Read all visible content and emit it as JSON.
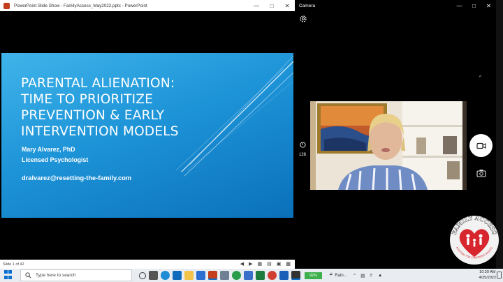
{
  "powerpoint": {
    "window_title": "PowerPoint Slide Show  -  FamilyAccess_May2022.pptx  -  PowerPoint",
    "slide": {
      "title_lines": [
        "PARENTAL ALIENATION:",
        "TIME TO PRIORITIZE",
        "PREVENTION & EARLY",
        "INTERVENTION MODELS"
      ],
      "author": "Mary Alvarez, PhD",
      "role": "Licensed Psychologist",
      "email": "dralvarez@resetting-the-family.com"
    },
    "status": {
      "slide_counter": "Slide 1 of 42"
    }
  },
  "camera": {
    "window_title": "Camera",
    "timer_value": "128"
  },
  "logo": {
    "text": "FAMILY ACCESS",
    "tagline": "FIGHTING FOR CHILDREN'S RIGHTS"
  },
  "taskbar": {
    "search_placeholder": "Type here to search",
    "battery": "92%",
    "weather": "Rain...",
    "time": "10:20 AM",
    "date": "4/25/2022"
  },
  "colors": {
    "slide_blue": "#1e94d8",
    "logo_red": "#d7262e",
    "taskbar": "#e9edf2"
  }
}
